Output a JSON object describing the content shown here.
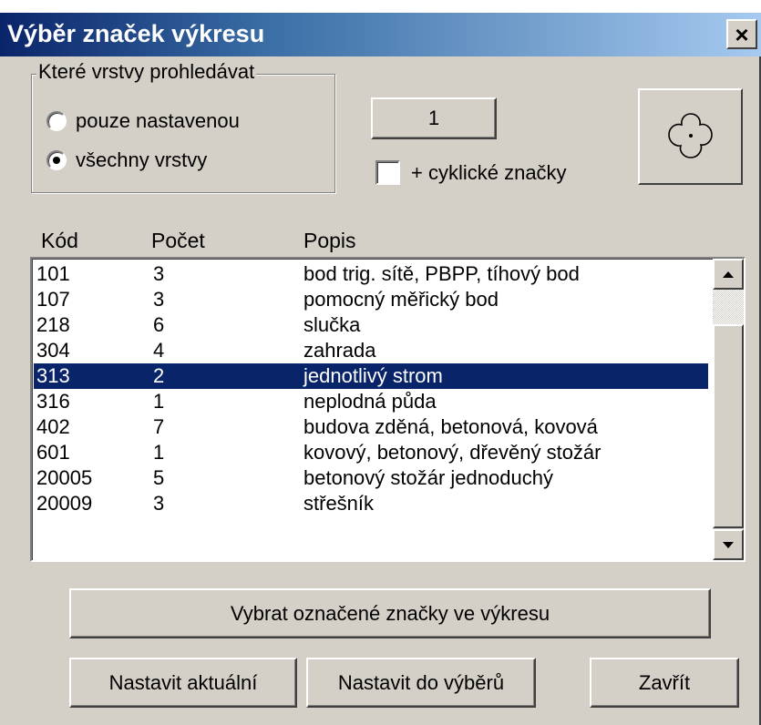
{
  "window": {
    "title": "Výběr značek výkresu",
    "close_label": "×"
  },
  "layers_group": {
    "legend": "Které vrstvy prohledávat",
    "options": [
      {
        "label": "pouze nastavenou",
        "checked": false
      },
      {
        "label": "všechny vrstvy",
        "checked": true
      }
    ]
  },
  "number_button": {
    "label": "1"
  },
  "cyclic": {
    "label": "+ cyklické značky",
    "checked": false
  },
  "preview": {
    "icon": "quatrefoil-symbol-icon"
  },
  "list": {
    "headers": {
      "kod": "Kód",
      "pocet": "Počet",
      "popis": "Popis"
    },
    "rows": [
      {
        "kod": "101",
        "pocet": "3",
        "popis": "bod trig. sítě, PBPP, tíhový bod"
      },
      {
        "kod": "107",
        "pocet": "3",
        "popis": "pomocný měřický bod"
      },
      {
        "kod": "218",
        "pocet": "6",
        "popis": "slučka"
      },
      {
        "kod": "304",
        "pocet": "4",
        "popis": "zahrada"
      },
      {
        "kod": "313",
        "pocet": "2",
        "popis": "jednotlivý strom",
        "selected": true
      },
      {
        "kod": "316",
        "pocet": "1",
        "popis": "neplodná půda"
      },
      {
        "kod": "402",
        "pocet": "7",
        "popis": "budova zděná, betonová, kovová"
      },
      {
        "kod": "601",
        "pocet": "1",
        "popis": "kovový, betonový, dřevěný stožár"
      },
      {
        "kod": "20005",
        "pocet": "5",
        "popis": "betonový stožár jednoduchý"
      },
      {
        "kod": "20009",
        "pocet": "3",
        "popis": "střešník"
      }
    ],
    "selection_color": "#0a246a"
  },
  "buttons": {
    "select_in_drawing": "Vybrat označené značky ve výkresu",
    "set_current": "Nastavit aktuální",
    "set_to_selection": "Nastavit do výběrů",
    "close": "Zavřít"
  },
  "colors": {
    "face": "#d4d0c8",
    "title_start": "#0a246a",
    "title_end": "#a6caf0"
  }
}
